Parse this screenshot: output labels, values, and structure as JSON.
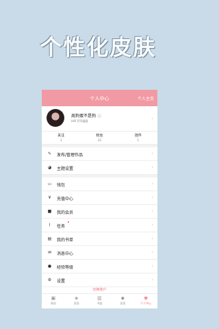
{
  "headline": "个性化皮肤",
  "header": {
    "title": "个人中心",
    "right_link": "个人主页",
    "accent": "#f19aa4"
  },
  "profile": {
    "name": "周狗蛋不是狗",
    "badge": "☺",
    "subtitle": "LV6 写写画画"
  },
  "stats": [
    {
      "label": "关注",
      "value": "1"
    },
    {
      "label": "粉丝",
      "value": "22"
    },
    {
      "label": "挂件",
      "value": "1"
    }
  ],
  "group1": [
    {
      "label": "发布/管理作品",
      "icon": "edit-icon"
    },
    {
      "label": "主题设置",
      "icon": "palette-icon"
    }
  ],
  "group2": [
    {
      "label": "钱包",
      "icon": "wallet-icon"
    },
    {
      "label": "充值中心",
      "icon": "yen-icon"
    },
    {
      "label": "我的会员",
      "icon": "vip-card-icon"
    },
    {
      "label": "任务",
      "icon": "paperclip-icon"
    },
    {
      "label": "我的书单",
      "icon": "book-list-icon"
    },
    {
      "label": "消息中心",
      "icon": "message-icon"
    },
    {
      "label": "经验等级",
      "icon": "level-icon"
    },
    {
      "label": "设置",
      "icon": "gear-icon"
    }
  ],
  "switch_account": "切换账户",
  "tabs": [
    {
      "label": "原创",
      "icon": "original-icon"
    },
    {
      "label": "发现",
      "icon": "discover-icon"
    },
    {
      "label": "书架",
      "icon": "bookshelf-icon"
    },
    {
      "label": "发现",
      "icon": "discover-icon"
    },
    {
      "label": "个人中心",
      "icon": "profile-icon",
      "active": true
    }
  ]
}
